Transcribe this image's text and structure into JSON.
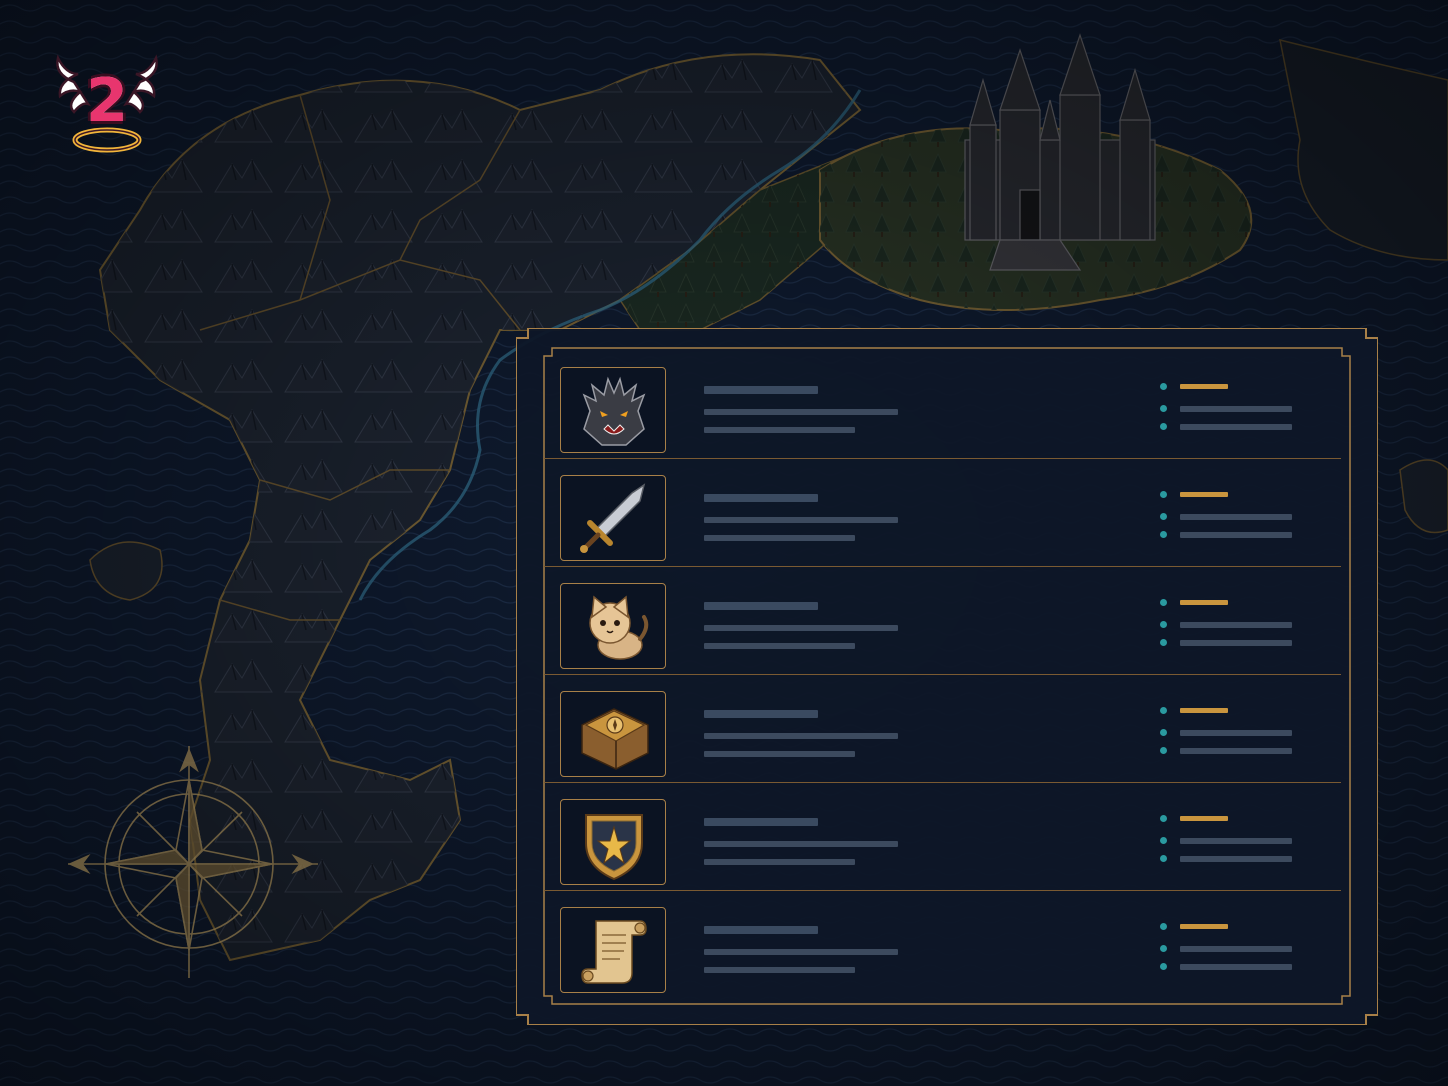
{
  "hud": {
    "level_badge": {
      "value": "2",
      "icon": "winged-halo-badge-icon"
    },
    "compass": {
      "icon": "compass-rose-icon"
    }
  },
  "colors": {
    "background": "#0d1626",
    "panel_fill": "#0e1728",
    "panel_border": "#a88048",
    "accent_gold": "#c9953e",
    "accent_teal": "#2a9aa0",
    "placeholder_bar": "#3c4a5e",
    "badge_pink": "#e8356e"
  },
  "entries": [
    {
      "icon": "monster-head-icon"
    },
    {
      "icon": "sword-icon"
    },
    {
      "icon": "cat-pet-icon"
    },
    {
      "icon": "spellbook-icon"
    },
    {
      "icon": "star-shield-icon"
    },
    {
      "icon": "scroll-icon"
    }
  ]
}
